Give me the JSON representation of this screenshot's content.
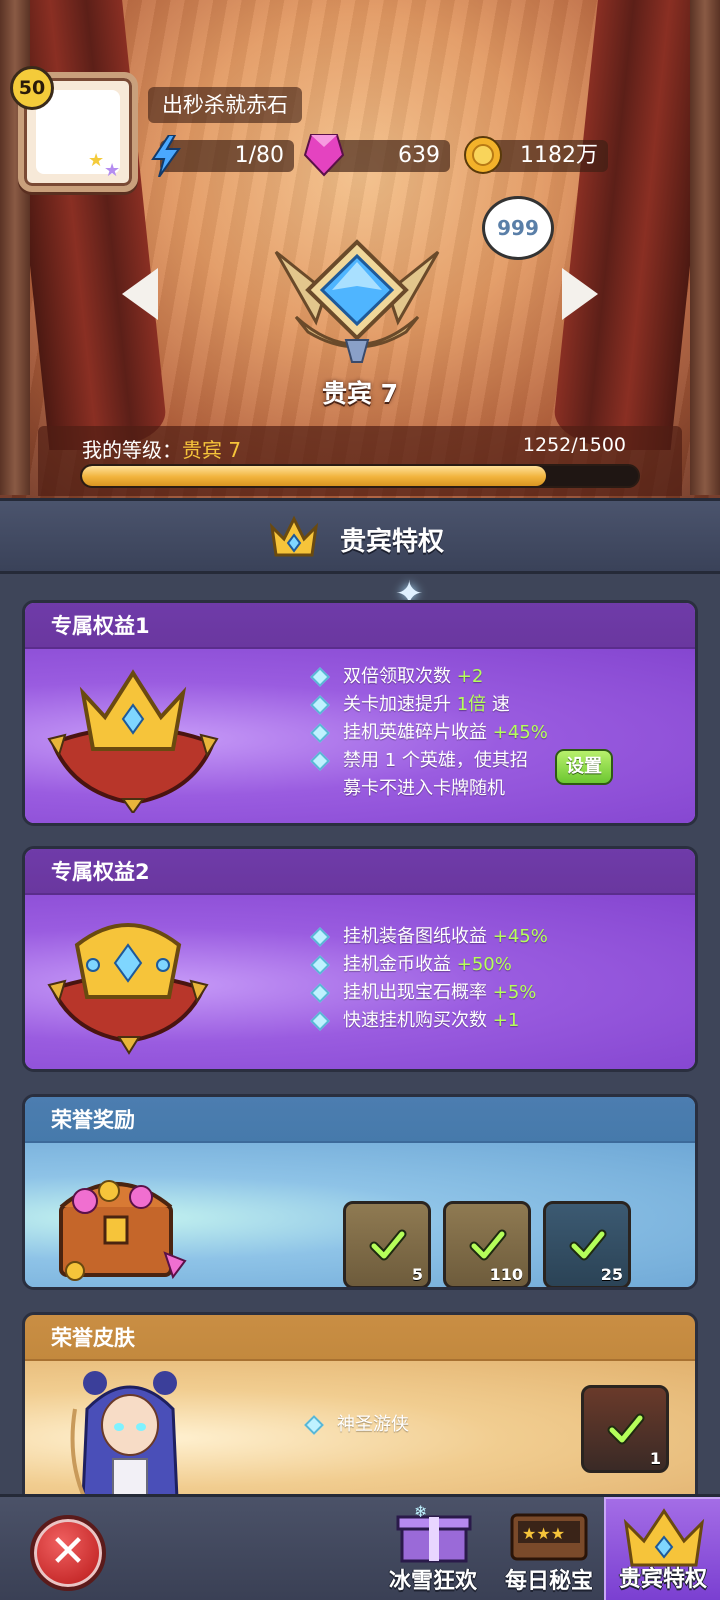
{
  "player": {
    "level": "50",
    "name": "出秒杀就赤石"
  },
  "resources": {
    "energy": "1/80",
    "gems": "639",
    "gold": "1182万"
  },
  "vip": {
    "notification_count": "999",
    "title": "贵宾 7",
    "level_label": "我的等级：",
    "level_value": "贵宾 7",
    "progress_text": "1252/1500",
    "progress_fraction": 0.835
  },
  "section": {
    "title": "贵宾特权"
  },
  "perk1": {
    "title": "专属权益1",
    "items": [
      {
        "text": "双倍领取次数 ",
        "value": "+2",
        "suffix": ""
      },
      {
        "text": "关卡加速提升 ",
        "value": "1倍",
        "suffix": " 速"
      },
      {
        "text": "挂机英雄碎片收益 ",
        "value": "+45%",
        "suffix": ""
      },
      {
        "text": "禁用 1 个英雄，使其招",
        "value": "",
        "suffix": ""
      }
    ],
    "line2": "募卡不进入卡牌随机",
    "set_button": "设置"
  },
  "perk2": {
    "title": "专属权益2",
    "items": [
      {
        "text": "挂机装备图纸收益 ",
        "value": "+45%"
      },
      {
        "text": "挂机金币收益 ",
        "value": "+50%"
      },
      {
        "text": "挂机出现宝石概率 ",
        "value": "+5%"
      },
      {
        "text": "快速挂机购买次数 ",
        "value": "+1"
      }
    ]
  },
  "honor_reward": {
    "title": "荣誉奖励",
    "rewards": [
      {
        "qty": "5"
      },
      {
        "qty": "110"
      },
      {
        "qty": "25"
      }
    ]
  },
  "honor_skin": {
    "title": "荣誉皮肤",
    "skin_name": "神圣游侠",
    "qty": "1"
  },
  "nav": {
    "tabs": [
      {
        "label": "冰雪狂欢"
      },
      {
        "label": "每日秘宝"
      },
      {
        "label": "贵宾特权"
      }
    ]
  },
  "colors": {
    "accent_green": "#b5ff5a",
    "gold": "#f6c43a",
    "purple": "#8d4fd6"
  }
}
